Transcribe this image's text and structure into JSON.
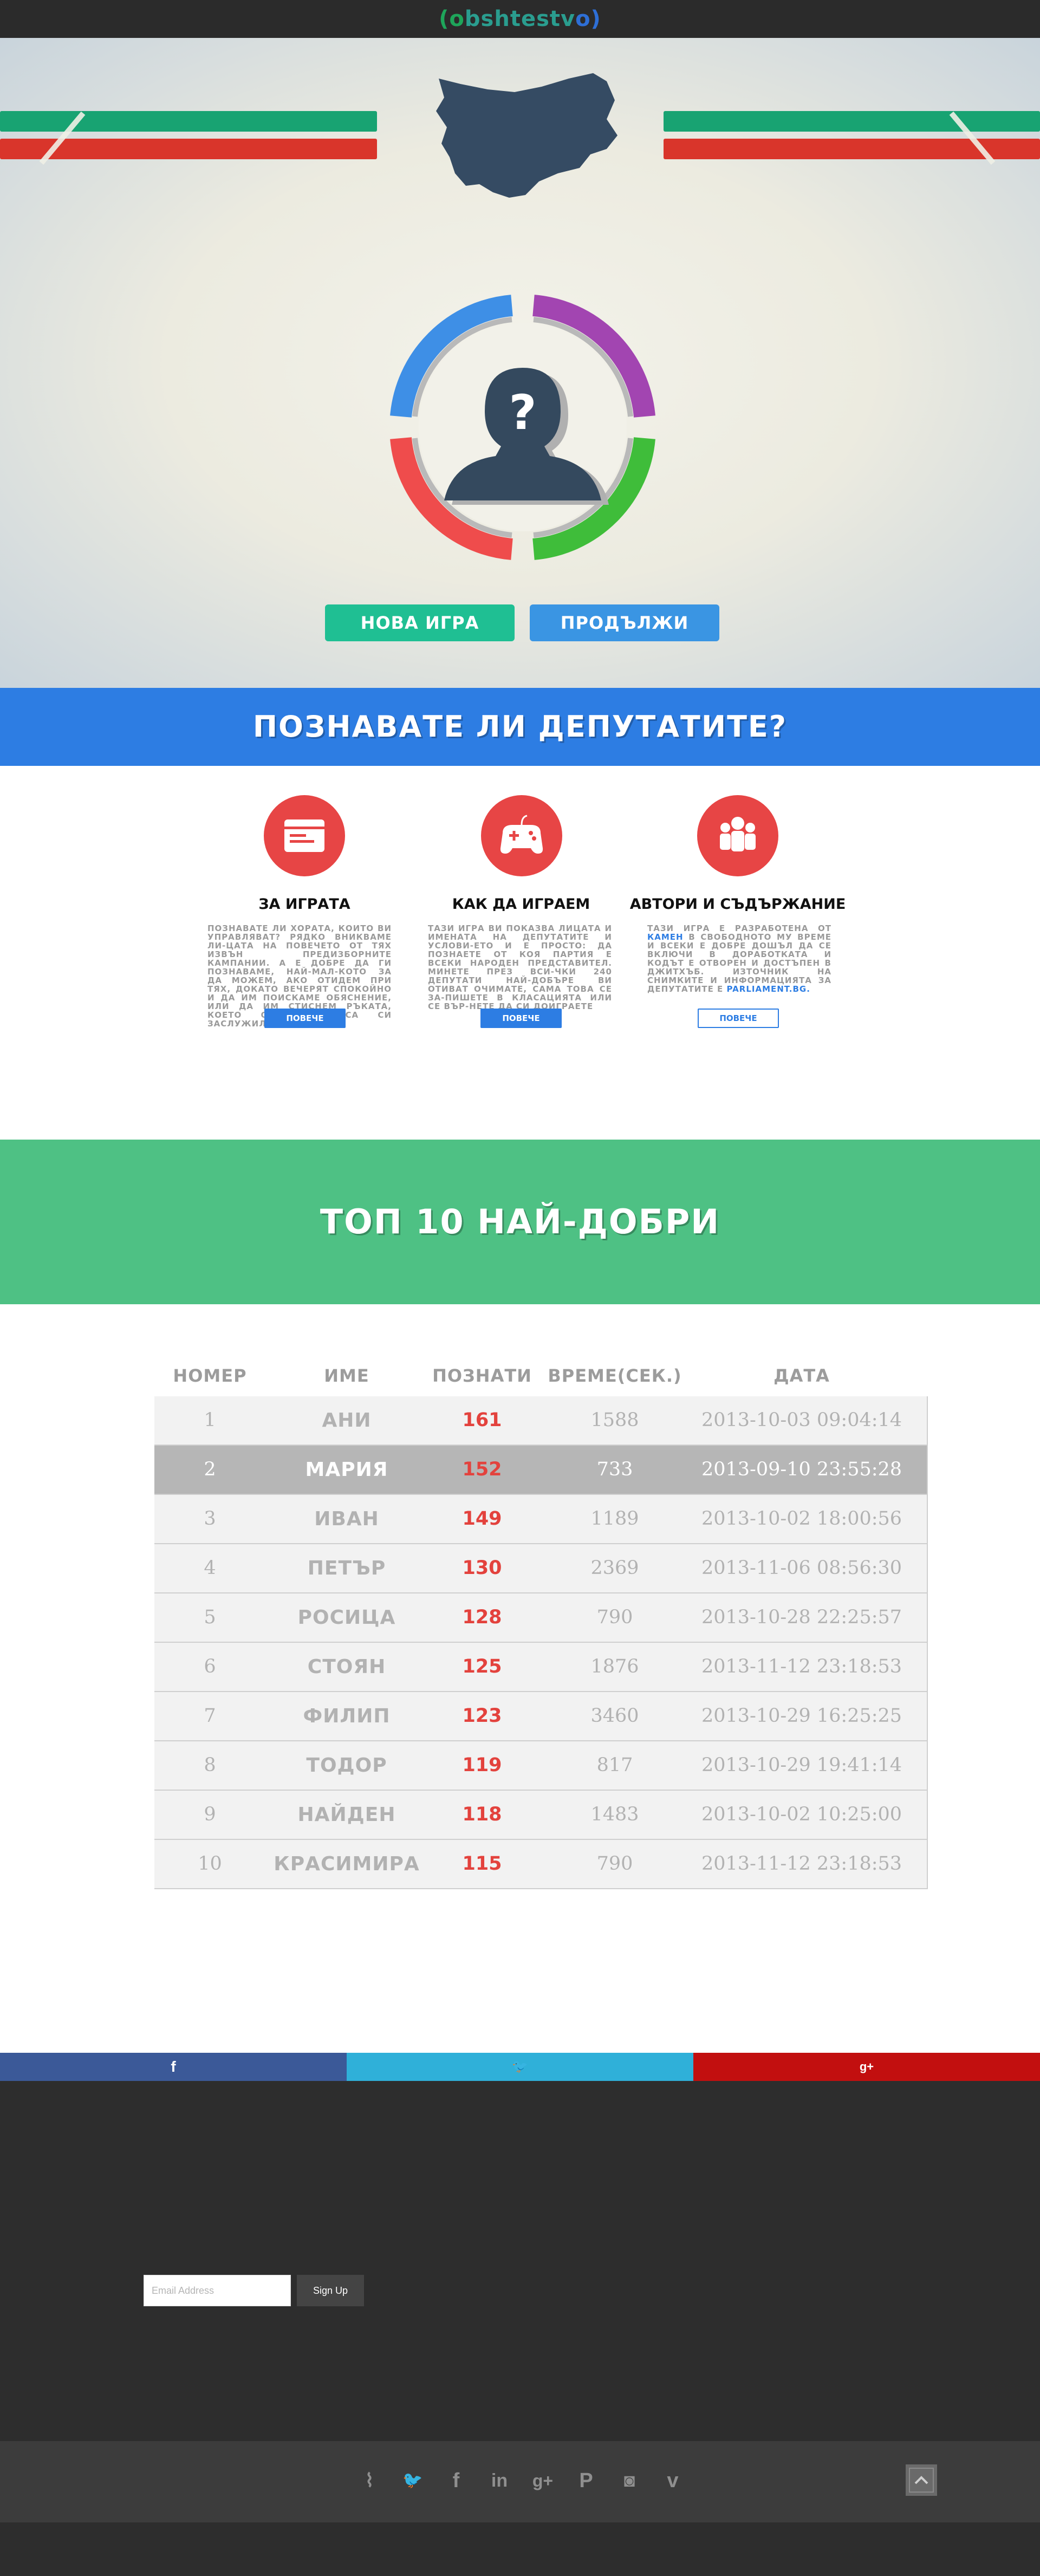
{
  "header": {
    "logo": {
      "left": "(o",
      "main": "bshtestv",
      "right": "o)"
    }
  },
  "hero": {
    "buttons": {
      "new_game": "НОВА ИГРА",
      "continue": "ПРОДЪЛЖИ"
    },
    "colors": {
      "green": "#18a372",
      "red": "#d9352b",
      "map": "#354b63"
    }
  },
  "quiz_banner": {
    "title": "ПОЗНАВАТЕ ЛИ ДЕПУТАТИТЕ?",
    "color": "#2d7de3"
  },
  "features": [
    {
      "icon": "browser-window-icon",
      "title": "ЗА ИГРАТА",
      "text": "ПОЗНАВАТЕ ЛИ ХОРАТА, КОИТО ВИ УПРАВЛЯВАТ? РЯДКО ВНИКВАМЕ ЛИ-ЦАТА НА ПОВЕЧЕТО ОТ ТЯХ ИЗВЪН ПРЕДИЗБОРНИТЕ КАМПАНИИ. А Е ДОБРЕ ДА ГИ ПОЗНАВАМЕ, НАЙ-МАЛ-КОТО ЗА ДА МОЖЕМ, АКО ОТИДЕМ ПРИ ТЯХ, ДОКАТО ВЕЧЕРЯТ СПОКОЙНО И ДА ИМ ПОИСКАМЕ ОБЯСНЕНИЕ, ИЛИ ДА ИМ СТИСНЕМ РЪКАТА, КОЕТО ОТ ДВЕТЕ СА СИ ЗАСЛУЖИЛИ.",
      "more": "ПОВЕЧЕ"
    },
    {
      "icon": "gamepad-icon",
      "title": "КАК ДА ИГРАЕМ",
      "text": "ТАЗИ ИГРА ВИ ПОКАЗВА ЛИЦАТА И ИМЕНАТА НА ДЕПУТАТИТЕ И УСЛОВИ-ЕТО И Е ПРОСТО: ДА ПОЗНАЕТЕ ОТ КОЯ ПАРТИЯ Е ВСЕКИ НАРОДЕН ПРЕДСТАВИТЕЛ. МИНЕТЕ ПРЕЗ ВСИ-ЧКИ 240 ДЕПУТАТИ НАЙ-ДОБЪРЕ ВИ ОТИВАТ ОЧИМАТЕ, САМА ТОВА СЕ ЗА-ПИШЕТЕ В КЛАСАЦИЯТА ИЛИ СЕ ВЪР-НЕТЕ ДА СИ ДОИГРАЕТЕ",
      "more": "ПОВЕЧЕ"
    },
    {
      "icon": "people-group-icon",
      "title": "АВТОРИ И СЪДЪРЖАНИЕ",
      "text_before": "ТАЗИ ИГРА Е РАЗРАБОТЕНА ОТ",
      "link1": "КАМЕН",
      "text_middle": "В СВОБОДНОТО МУ ВРЕМЕ И ВСЕКИ Е ДОБРЕ ДОШЪЛ ДА СЕ ВКЛЮЧИ В ДОРАБОТКАТА И КОДЪТ Е ОТВОРЕН И ДОСТЪПЕН В ДЖИТХЪБ. ИЗТОЧНИК НА СНИМКИТЕ И ИНФОРМАЦИЯТА ЗА ДЕПУТАТИТЕ Е",
      "link2": "PARLIAMENT.BG.",
      "more": "ПОВЕЧЕ"
    }
  ],
  "top_banner": {
    "title": "ТОП 10 НАЙ-ДОБРИ",
    "color": "#4ec184"
  },
  "table": {
    "headers": [
      "НОМЕР",
      "ИМЕ",
      "ПОЗНАТИ",
      "ВРЕМЕ(СЕК.)",
      "ДАТА"
    ],
    "rows": [
      [
        "1",
        "АНИ",
        "161",
        "1588",
        "2013-10-03 09:04:14"
      ],
      [
        "2",
        "МАРИЯ",
        "152",
        "733",
        "2013-09-10 23:55:28"
      ],
      [
        "3",
        "ИВАН",
        "149",
        "1189",
        "2013-10-02 18:00:56"
      ],
      [
        "4",
        "ПЕТЪР",
        "130",
        "2369",
        "2013-11-06 08:56:30"
      ],
      [
        "5",
        "РОСИЦА",
        "128",
        "790",
        "2013-10-28 22:25:57"
      ],
      [
        "6",
        "СТОЯН",
        "125",
        "1876",
        "2013-11-12 23:18:53"
      ],
      [
        "7",
        "ФИЛИП",
        "123",
        "3460",
        "2013-10-29 16:25:25"
      ],
      [
        "8",
        "ТОДОР",
        "119",
        "817",
        "2013-10-29 19:41:14"
      ],
      [
        "9",
        "НАЙДЕН",
        "118",
        "1483",
        "2013-10-02 10:25:00"
      ],
      [
        "10",
        "КРАСИМИРА",
        "115",
        "790",
        "2013-11-12 23:18:53"
      ]
    ]
  },
  "social": {
    "facebook": {
      "glyph": "f",
      "color": "#3b5998"
    },
    "twitter": {
      "glyph": "🐦",
      "color": "#2fb0d9"
    },
    "google": {
      "glyph": "g+",
      "color": "#c20f0f"
    }
  },
  "newsletter": {
    "placeholder": "Email Address",
    "button": "Sign Up"
  },
  "footer_icons": [
    {
      "name": "rss-icon",
      "glyph": "⌇"
    },
    {
      "name": "twitter-icon",
      "glyph": "🐦"
    },
    {
      "name": "facebook-icon",
      "glyph": "f"
    },
    {
      "name": "linkedin-icon",
      "glyph": "in"
    },
    {
      "name": "googleplus-icon",
      "glyph": "g+"
    },
    {
      "name": "pinterest-icon",
      "glyph": "P"
    },
    {
      "name": "instagram-icon",
      "glyph": "◙"
    },
    {
      "name": "vimeo-icon",
      "glyph": "v"
    }
  ]
}
